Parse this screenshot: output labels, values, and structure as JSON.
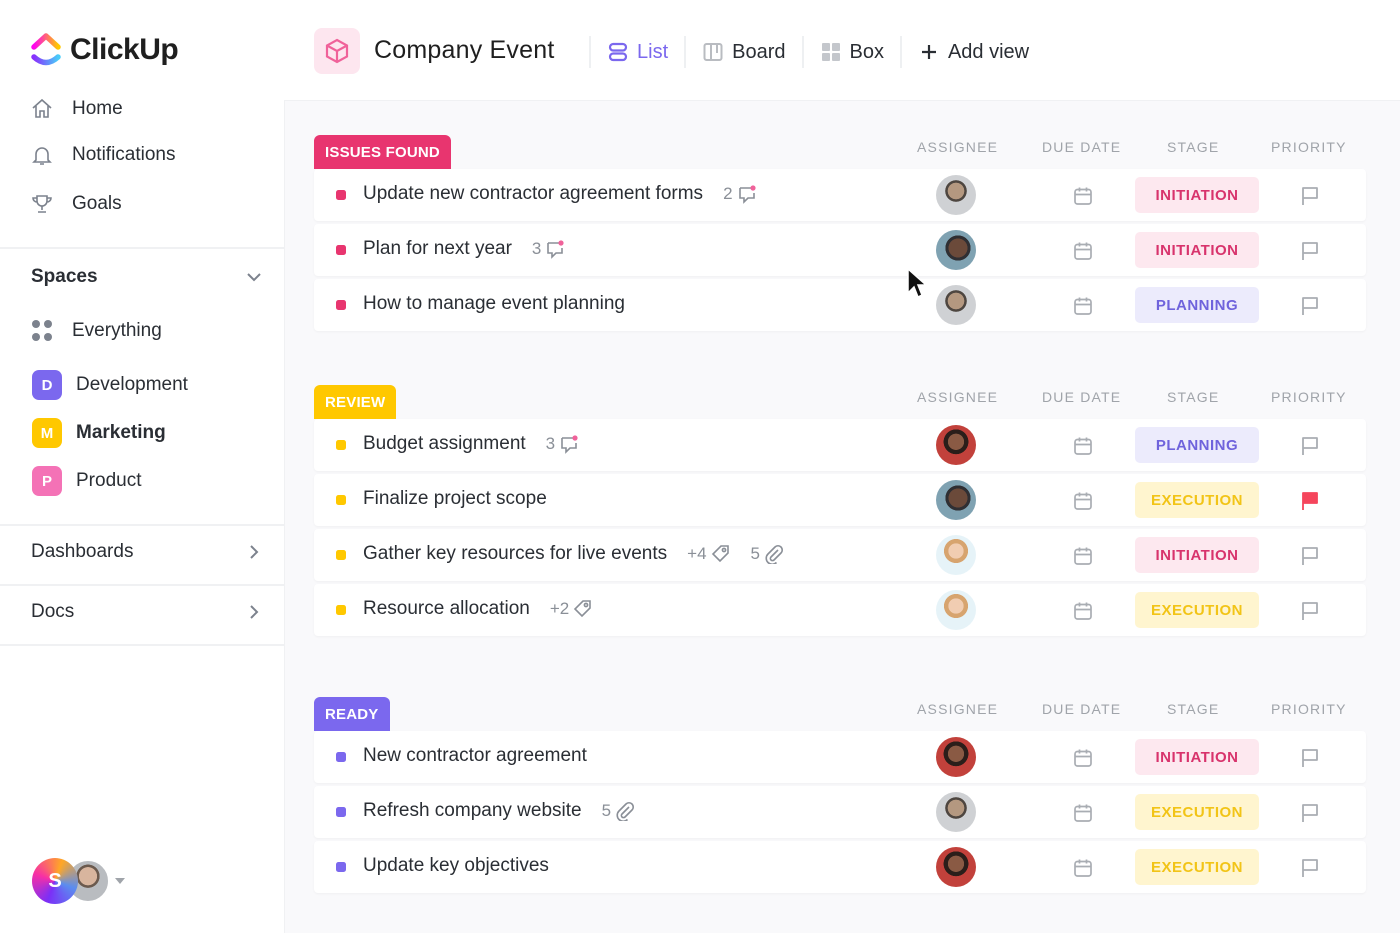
{
  "app": {
    "brand": "ClickUp"
  },
  "sidebar": {
    "nav": [
      {
        "label": "Home",
        "icon": "home-icon"
      },
      {
        "label": "Notifications",
        "icon": "bell-icon"
      },
      {
        "label": "Goals",
        "icon": "trophy-icon"
      }
    ],
    "spaces_label": "Spaces",
    "everything_label": "Everything",
    "spaces": [
      {
        "letter": "D",
        "label": "Development",
        "color": "#7b68ee"
      },
      {
        "letter": "M",
        "label": "Marketing",
        "color": "#ffc800"
      },
      {
        "letter": "P",
        "label": "Product",
        "color": "#f472b6"
      }
    ],
    "dashboards_label": "Dashboards",
    "docs_label": "Docs",
    "user_initial": "S"
  },
  "header": {
    "project_title": "Company Event",
    "views": [
      {
        "label": "List",
        "icon": "list-icon",
        "active": true
      },
      {
        "label": "Board",
        "icon": "board-icon",
        "active": false
      },
      {
        "label": "Box",
        "icon": "box-icon",
        "active": false
      }
    ],
    "add_view_label": "Add view"
  },
  "columns": {
    "assignee": "ASSIGNEE",
    "due_date": "DUE DATE",
    "stage": "STAGE",
    "priority": "PRIORITY"
  },
  "groups": [
    {
      "name": "ISSUES FOUND",
      "color": "#e8356f",
      "tasks": [
        {
          "title": "Update new contractor agreement forms",
          "comments": "2",
          "stage": "INITIATION",
          "assignee": "man1",
          "priority_flag": false
        },
        {
          "title": "Plan for next year",
          "comments": "3",
          "stage": "INITIATION",
          "assignee": "man2",
          "priority_flag": false
        },
        {
          "title": "How to manage event planning",
          "stage": "PLANNING",
          "assignee": "man1",
          "priority_flag": false
        }
      ]
    },
    {
      "name": "REVIEW",
      "color": "#ffc800",
      "tasks": [
        {
          "title": "Budget assignment",
          "comments": "3",
          "stage": "PLANNING",
          "assignee": "woman1",
          "priority_flag": false
        },
        {
          "title": "Finalize project scope",
          "stage": "EXECUTION",
          "assignee": "man2",
          "priority_flag": true
        },
        {
          "title": "Gather key resources for live events",
          "tags": "+4",
          "attachments": "5",
          "stage": "INITIATION",
          "assignee": "woman2",
          "priority_flag": false
        },
        {
          "title": "Resource allocation",
          "tags": "+2",
          "stage": "EXECUTION",
          "assignee": "woman2",
          "priority_flag": false
        }
      ]
    },
    {
      "name": "READY",
      "color": "#7b68ee",
      "tasks": [
        {
          "title": "New contractor agreement",
          "stage": "INITIATION",
          "assignee": "woman1",
          "priority_flag": false
        },
        {
          "title": "Refresh company website",
          "attachments": "5",
          "stage": "EXECUTION",
          "assignee": "man1",
          "priority_flag": false
        },
        {
          "title": "Update key objectives",
          "stage": "EXECUTION",
          "assignee": "woman1",
          "priority_flag": false
        }
      ]
    }
  ],
  "colors": {
    "accent": "#7b68ee",
    "urgent_flag": "#f5455c"
  }
}
